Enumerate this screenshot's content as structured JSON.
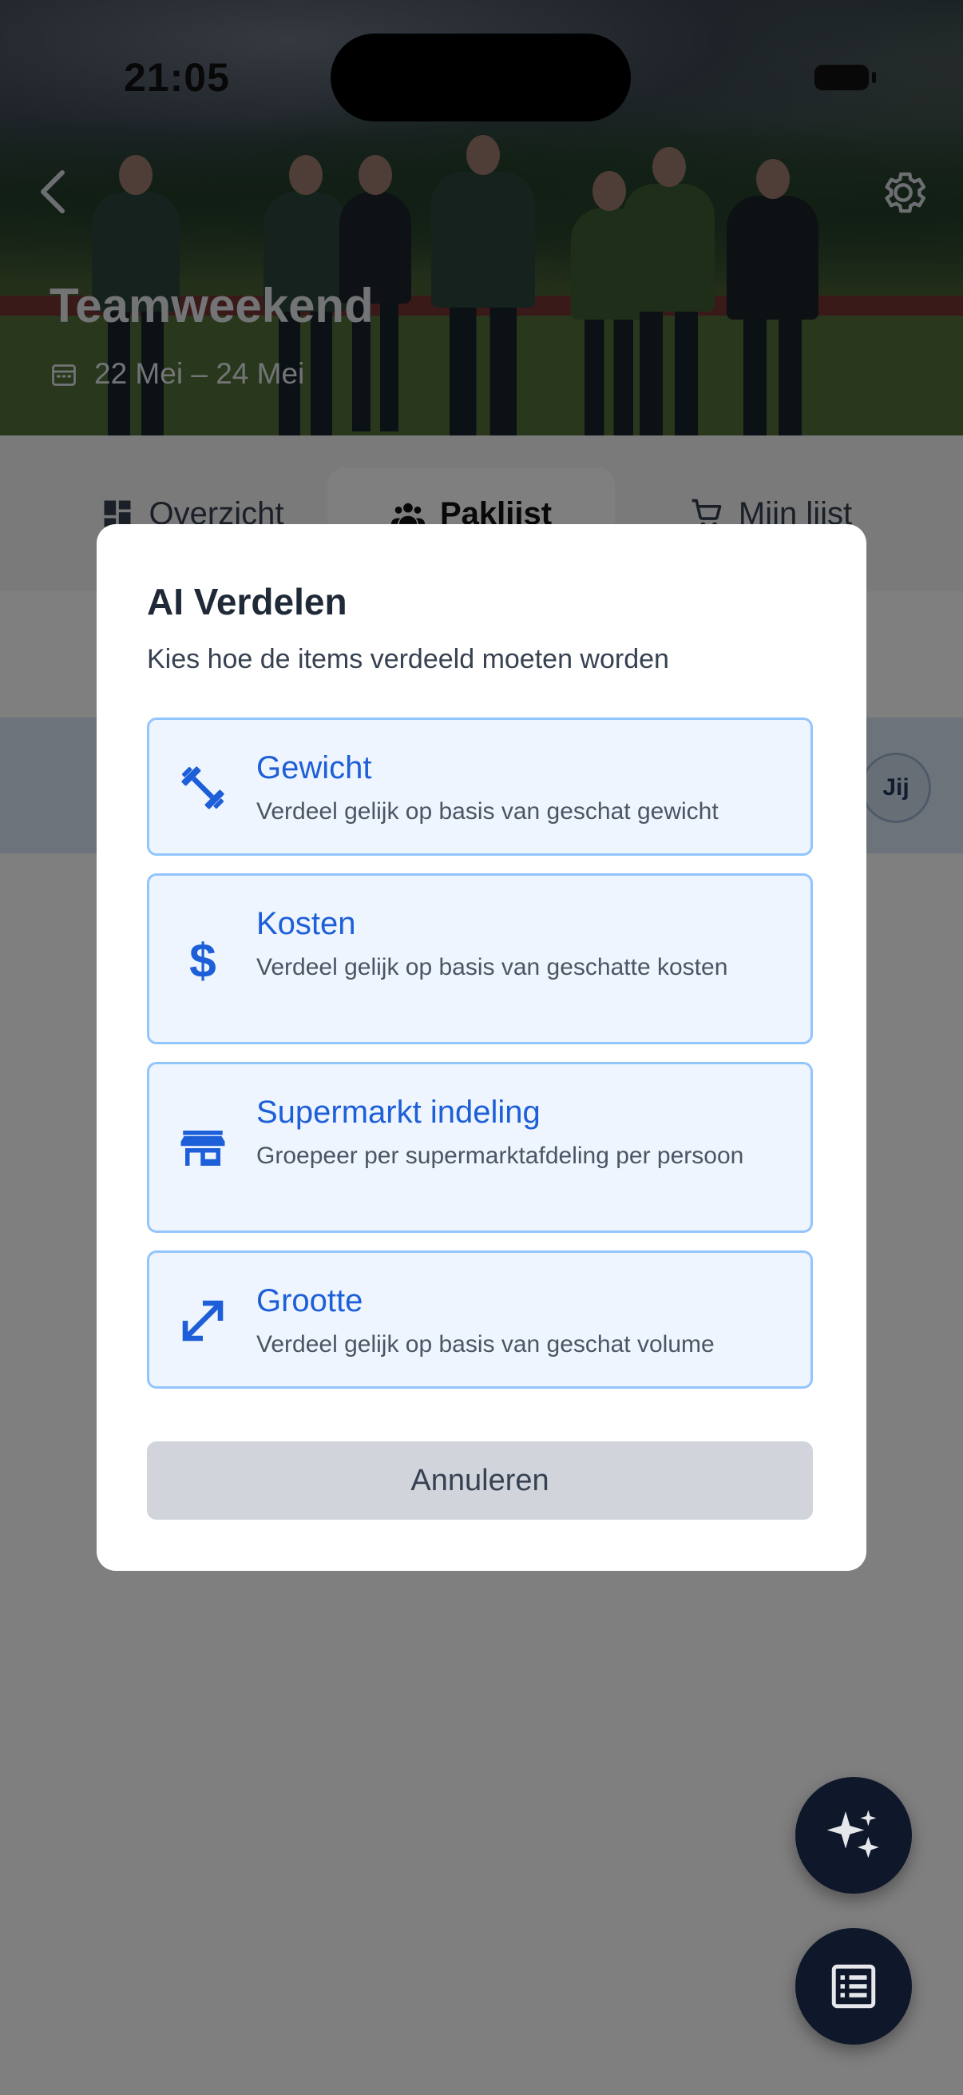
{
  "status_bar": {
    "time": "21:05"
  },
  "hero": {
    "title": "Teamweekend",
    "date_range": "22 Mei – 24 Mei"
  },
  "tabs": [
    {
      "label": "Overzicht",
      "icon": "dashboard-icon",
      "active": false
    },
    {
      "label": "Paklijst",
      "icon": "group-icon",
      "active": true
    },
    {
      "label": "Mijn lijst",
      "icon": "cart-icon",
      "active": false
    }
  ],
  "list": {
    "me_badge": "Jij"
  },
  "modal": {
    "title": "AI Verdelen",
    "subtitle": "Kies hoe de items verdeeld moeten worden",
    "options": [
      {
        "icon": "dumbbell-icon",
        "title": "Gewicht",
        "description": "Verdeel gelijk op basis van geschat gewicht"
      },
      {
        "icon": "dollar-icon",
        "title": "Kosten",
        "description": "Verdeel gelijk op basis van geschatte kosten"
      },
      {
        "icon": "store-icon",
        "title": "Supermarkt indeling",
        "description": "Groepeer per supermarktafdeling per persoon"
      },
      {
        "icon": "resize-icon",
        "title": "Grootte",
        "description": "Verdeel gelijk op basis van geschat volume"
      }
    ],
    "cancel_label": "Annuleren"
  },
  "colors": {
    "accent": "#1d5fd8",
    "option_bg": "#eef5fe",
    "option_border": "#93c5fd",
    "fab_bg": "#0f172a",
    "overlay": "rgba(0,0,0,0.5)"
  }
}
